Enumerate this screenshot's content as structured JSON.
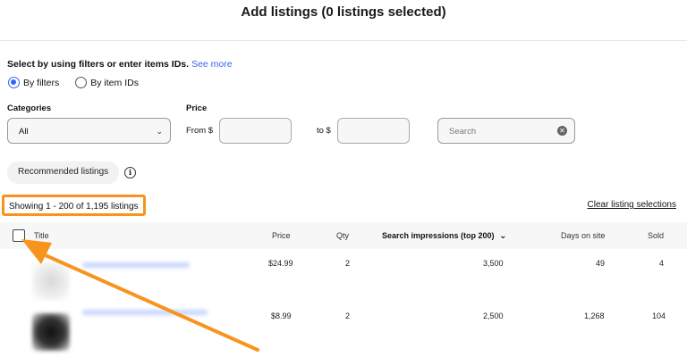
{
  "header": {
    "title": "Add listings (0 listings selected)"
  },
  "selection": {
    "hint": "Select by using filters or enter items IDs.",
    "see_more": "See more",
    "options": [
      {
        "label": "By filters",
        "selected": true
      },
      {
        "label": "By item IDs",
        "selected": false
      }
    ]
  },
  "filters": {
    "categories_label": "Categories",
    "categories_value": "All",
    "price_label": "Price",
    "from_label": "From $",
    "to_label": "to $",
    "search_placeholder": "Search"
  },
  "recommended": {
    "label": "Recommended listings"
  },
  "summary": {
    "showing": "Showing 1 - 200 of 1,195 listings",
    "clear_selections": "Clear listing selections"
  },
  "table": {
    "columns": {
      "title": "Title",
      "price": "Price",
      "qty": "Qty",
      "impressions": "Search impressions (top 200)",
      "days": "Days on site",
      "sold": "Sold"
    },
    "rows": [
      {
        "price": "$24.99",
        "qty": "2",
        "impressions": "3,500",
        "days": "49",
        "sold": "4"
      },
      {
        "price": "$8.99",
        "qty": "2",
        "impressions": "2,500",
        "days": "1,268",
        "sold": "104"
      }
    ]
  },
  "colors": {
    "accent": "#3665f3",
    "highlight": "#f7941d"
  }
}
